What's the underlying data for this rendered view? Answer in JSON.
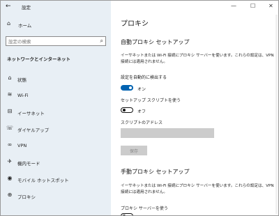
{
  "app": {
    "title": "設定"
  },
  "window_controls": {
    "minimize": "—",
    "maximize": "☐",
    "close": "✕"
  },
  "sidebar": {
    "home_label": "ホーム",
    "search_placeholder": "設定の検索",
    "section_title": "ネットワークとインターネット",
    "items": [
      {
        "label": "状態",
        "icon": "globe-icon",
        "glyph": "⌂"
      },
      {
        "label": "Wi-Fi",
        "icon": "wifi-icon",
        "glyph": "≋"
      },
      {
        "label": "イーサネット",
        "icon": "ethernet-icon",
        "glyph": "⊟"
      },
      {
        "label": "ダイヤルアップ",
        "icon": "phone-icon",
        "glyph": "☏"
      },
      {
        "label": "VPN",
        "icon": "vpn-icon",
        "glyph": "∞"
      },
      {
        "label": "機内モード",
        "icon": "airplane-icon",
        "glyph": "✈"
      },
      {
        "label": "モバイル ホットスポット",
        "icon": "hotspot-icon",
        "glyph": "◉"
      },
      {
        "label": "プロキシ",
        "icon": "proxy-globe-icon",
        "glyph": "⊕"
      }
    ]
  },
  "main": {
    "page_title": "プロキシ",
    "auto": {
      "heading": "自動プロキシ セットアップ",
      "description": "イーサネットまたは Wi-Fi 接続にプロキシ サーバーを使います。これらの設定は、VPN 接続には適用されません。",
      "detect_label": "設定を自動的に検出する",
      "detect_state": "オン",
      "script_label": "セットアップ スクリプトを使う",
      "script_state": "オフ",
      "address_label": "スクリプトのアドレス",
      "address_value": "",
      "save_label": "保存"
    },
    "manual": {
      "heading": "手動プロキシ セットアップ",
      "description": "イーサネットまたは Wi-Fi 接続にプロキシ サーバーを使います。これらの設定は、VPN 接続には適用されません。",
      "use_proxy_label": "プロキシ サーバーを使う"
    }
  },
  "colors": {
    "accent": "#0063b1",
    "sidebar_bg": "#e8eff5"
  }
}
